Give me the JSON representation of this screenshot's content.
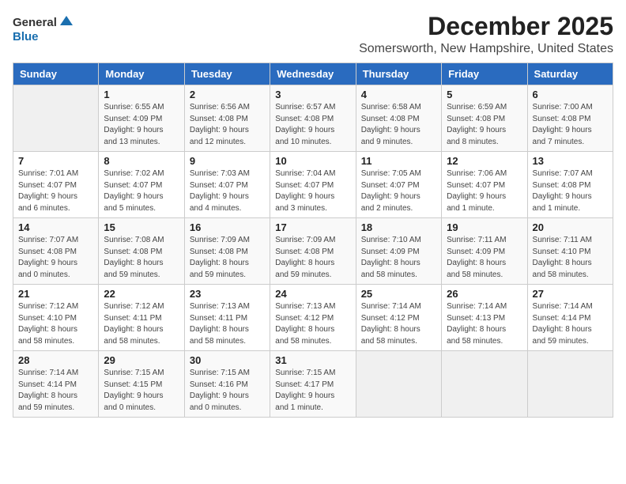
{
  "logo": {
    "general": "General",
    "blue": "Blue"
  },
  "title": "December 2025",
  "location": "Somersworth, New Hampshire, United States",
  "days_of_week": [
    "Sunday",
    "Monday",
    "Tuesday",
    "Wednesday",
    "Thursday",
    "Friday",
    "Saturday"
  ],
  "weeks": [
    [
      {
        "day": "",
        "info": ""
      },
      {
        "day": "1",
        "info": "Sunrise: 6:55 AM\nSunset: 4:09 PM\nDaylight: 9 hours\nand 13 minutes."
      },
      {
        "day": "2",
        "info": "Sunrise: 6:56 AM\nSunset: 4:08 PM\nDaylight: 9 hours\nand 12 minutes."
      },
      {
        "day": "3",
        "info": "Sunrise: 6:57 AM\nSunset: 4:08 PM\nDaylight: 9 hours\nand 10 minutes."
      },
      {
        "day": "4",
        "info": "Sunrise: 6:58 AM\nSunset: 4:08 PM\nDaylight: 9 hours\nand 9 minutes."
      },
      {
        "day": "5",
        "info": "Sunrise: 6:59 AM\nSunset: 4:08 PM\nDaylight: 9 hours\nand 8 minutes."
      },
      {
        "day": "6",
        "info": "Sunrise: 7:00 AM\nSunset: 4:08 PM\nDaylight: 9 hours\nand 7 minutes."
      }
    ],
    [
      {
        "day": "7",
        "info": "Sunrise: 7:01 AM\nSunset: 4:07 PM\nDaylight: 9 hours\nand 6 minutes."
      },
      {
        "day": "8",
        "info": "Sunrise: 7:02 AM\nSunset: 4:07 PM\nDaylight: 9 hours\nand 5 minutes."
      },
      {
        "day": "9",
        "info": "Sunrise: 7:03 AM\nSunset: 4:07 PM\nDaylight: 9 hours\nand 4 minutes."
      },
      {
        "day": "10",
        "info": "Sunrise: 7:04 AM\nSunset: 4:07 PM\nDaylight: 9 hours\nand 3 minutes."
      },
      {
        "day": "11",
        "info": "Sunrise: 7:05 AM\nSunset: 4:07 PM\nDaylight: 9 hours\nand 2 minutes."
      },
      {
        "day": "12",
        "info": "Sunrise: 7:06 AM\nSunset: 4:07 PM\nDaylight: 9 hours\nand 1 minute."
      },
      {
        "day": "13",
        "info": "Sunrise: 7:07 AM\nSunset: 4:08 PM\nDaylight: 9 hours\nand 1 minute."
      }
    ],
    [
      {
        "day": "14",
        "info": "Sunrise: 7:07 AM\nSunset: 4:08 PM\nDaylight: 9 hours\nand 0 minutes."
      },
      {
        "day": "15",
        "info": "Sunrise: 7:08 AM\nSunset: 4:08 PM\nDaylight: 8 hours\nand 59 minutes."
      },
      {
        "day": "16",
        "info": "Sunrise: 7:09 AM\nSunset: 4:08 PM\nDaylight: 8 hours\nand 59 minutes."
      },
      {
        "day": "17",
        "info": "Sunrise: 7:09 AM\nSunset: 4:08 PM\nDaylight: 8 hours\nand 59 minutes."
      },
      {
        "day": "18",
        "info": "Sunrise: 7:10 AM\nSunset: 4:09 PM\nDaylight: 8 hours\nand 58 minutes."
      },
      {
        "day": "19",
        "info": "Sunrise: 7:11 AM\nSunset: 4:09 PM\nDaylight: 8 hours\nand 58 minutes."
      },
      {
        "day": "20",
        "info": "Sunrise: 7:11 AM\nSunset: 4:10 PM\nDaylight: 8 hours\nand 58 minutes."
      }
    ],
    [
      {
        "day": "21",
        "info": "Sunrise: 7:12 AM\nSunset: 4:10 PM\nDaylight: 8 hours\nand 58 minutes."
      },
      {
        "day": "22",
        "info": "Sunrise: 7:12 AM\nSunset: 4:11 PM\nDaylight: 8 hours\nand 58 minutes."
      },
      {
        "day": "23",
        "info": "Sunrise: 7:13 AM\nSunset: 4:11 PM\nDaylight: 8 hours\nand 58 minutes."
      },
      {
        "day": "24",
        "info": "Sunrise: 7:13 AM\nSunset: 4:12 PM\nDaylight: 8 hours\nand 58 minutes."
      },
      {
        "day": "25",
        "info": "Sunrise: 7:14 AM\nSunset: 4:12 PM\nDaylight: 8 hours\nand 58 minutes."
      },
      {
        "day": "26",
        "info": "Sunrise: 7:14 AM\nSunset: 4:13 PM\nDaylight: 8 hours\nand 58 minutes."
      },
      {
        "day": "27",
        "info": "Sunrise: 7:14 AM\nSunset: 4:14 PM\nDaylight: 8 hours\nand 59 minutes."
      }
    ],
    [
      {
        "day": "28",
        "info": "Sunrise: 7:14 AM\nSunset: 4:14 PM\nDaylight: 8 hours\nand 59 minutes."
      },
      {
        "day": "29",
        "info": "Sunrise: 7:15 AM\nSunset: 4:15 PM\nDaylight: 9 hours\nand 0 minutes."
      },
      {
        "day": "30",
        "info": "Sunrise: 7:15 AM\nSunset: 4:16 PM\nDaylight: 9 hours\nand 0 minutes."
      },
      {
        "day": "31",
        "info": "Sunrise: 7:15 AM\nSunset: 4:17 PM\nDaylight: 9 hours\nand 1 minute."
      },
      {
        "day": "",
        "info": ""
      },
      {
        "day": "",
        "info": ""
      },
      {
        "day": "",
        "info": ""
      }
    ]
  ]
}
